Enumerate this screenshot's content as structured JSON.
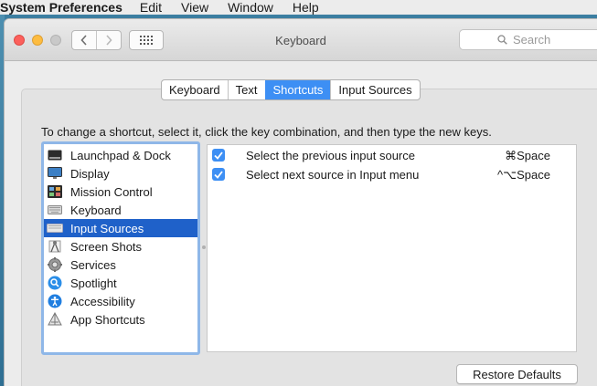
{
  "menubar": {
    "app": "System Preferences",
    "items": [
      "Edit",
      "View",
      "Window",
      "Help"
    ]
  },
  "window": {
    "title": "Keyboard",
    "search_placeholder": "Search",
    "nav": {
      "back_icon": "chevron-left-icon",
      "forward_icon": "chevron-right-icon",
      "show_all_icon": "grid-icon"
    }
  },
  "tabs": [
    {
      "label": "Keyboard",
      "selected": false
    },
    {
      "label": "Text",
      "selected": false
    },
    {
      "label": "Shortcuts",
      "selected": true
    },
    {
      "label": "Input Sources",
      "selected": false
    }
  ],
  "instruction": "To change a shortcut, select it, click the key combination, and then type the new keys.",
  "categories": [
    {
      "label": "Launchpad & Dock",
      "icon": "launchpad-dock-icon",
      "selected": false
    },
    {
      "label": "Display",
      "icon": "display-icon",
      "selected": false
    },
    {
      "label": "Mission Control",
      "icon": "mission-control-icon",
      "selected": false
    },
    {
      "label": "Keyboard",
      "icon": "keyboard-icon",
      "selected": false
    },
    {
      "label": "Input Sources",
      "icon": "input-sources-icon",
      "selected": true
    },
    {
      "label": "Screen Shots",
      "icon": "screenshot-icon",
      "selected": false
    },
    {
      "label": "Services",
      "icon": "gear-icon",
      "selected": false
    },
    {
      "label": "Spotlight",
      "icon": "spotlight-search-icon",
      "selected": false
    },
    {
      "label": "Accessibility",
      "icon": "accessibility-icon",
      "selected": false
    },
    {
      "label": "App Shortcuts",
      "icon": "app-shortcuts-icon",
      "selected": false
    }
  ],
  "shortcuts": [
    {
      "checked": true,
      "label": "Select the previous input source",
      "keys": "⌘Space"
    },
    {
      "checked": true,
      "label": "Select next source in Input menu",
      "keys": "^⌥Space"
    }
  ],
  "buttons": {
    "restore_defaults": "Restore Defaults"
  },
  "colors": {
    "accent": "#3d8ff4",
    "selection": "#1f61c9",
    "list_focus_ring": "#8fb7e8"
  }
}
